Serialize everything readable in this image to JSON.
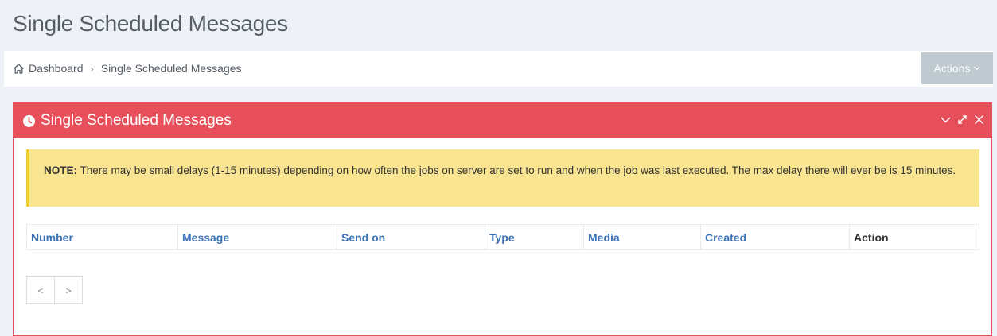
{
  "page": {
    "title": "Single Scheduled Messages"
  },
  "breadcrumb": {
    "home_icon": "home-icon",
    "home_label": "Dashboard",
    "separator": "›",
    "current": "Single Scheduled Messages"
  },
  "actions": {
    "label": "Actions",
    "chevron": "⌄"
  },
  "portlet": {
    "title": "Single Scheduled Messages",
    "icon": "clock-icon",
    "tools": [
      "collapse-icon",
      "fullscreen-icon",
      "close-icon"
    ],
    "accent_color": "#e7505a"
  },
  "note": {
    "label": "NOTE:",
    "text": "There may be small delays (1-15 minutes) depending on how often the jobs on server are set to run and when the job was last executed. The max delay there will ever be is 15 minutes."
  },
  "table": {
    "columns": [
      "Number",
      "Message",
      "Send on",
      "Type",
      "Media",
      "Created",
      "Action"
    ]
  },
  "pagination": {
    "prev": "<",
    "next": ">"
  }
}
